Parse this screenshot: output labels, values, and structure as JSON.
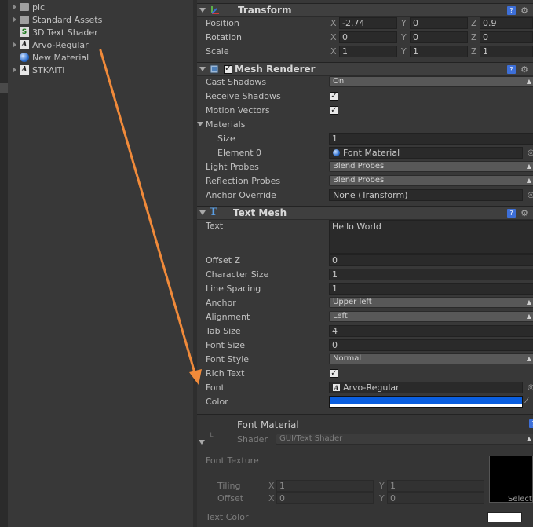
{
  "project": {
    "items": [
      {
        "name": "pic",
        "icon": "folder-icon",
        "expandable": true
      },
      {
        "name": "Standard Assets",
        "icon": "folder-icon",
        "expandable": true
      },
      {
        "name": "3D Text Shader",
        "icon": "shader-icon",
        "glyph": "S",
        "expandable": false
      },
      {
        "name": "Arvo-Regular",
        "icon": "font-icon",
        "glyph": "A",
        "expandable": true
      },
      {
        "name": "New Material",
        "icon": "material-icon",
        "expandable": false
      },
      {
        "name": "STKAITI",
        "icon": "font-icon",
        "glyph": "A",
        "expandable": true
      }
    ]
  },
  "transform": {
    "title": "Transform",
    "rows": [
      {
        "label": "Position",
        "x": "-2.74",
        "y": "0",
        "z": "0.9"
      },
      {
        "label": "Rotation",
        "x": "0",
        "y": "0",
        "z": "0"
      },
      {
        "label": "Scale",
        "x": "1",
        "y": "1",
        "z": "1"
      }
    ],
    "axis": {
      "x": "X",
      "y": "Y",
      "z": "Z"
    }
  },
  "mesh_renderer": {
    "title": "Mesh Renderer",
    "enabled": true,
    "cast_shadows": {
      "label": "Cast Shadows",
      "value": "On"
    },
    "receive_shadows": {
      "label": "Receive Shadows",
      "checked": true
    },
    "motion_vectors": {
      "label": "Motion Vectors",
      "checked": true
    },
    "materials": {
      "label": "Materials",
      "size_label": "Size",
      "size": "1",
      "element_label": "Element 0",
      "element_value": "Font Material"
    },
    "light_probes": {
      "label": "Light Probes",
      "value": "Blend Probes"
    },
    "reflection_probes": {
      "label": "Reflection Probes",
      "value": "Blend Probes"
    },
    "anchor_override": {
      "label": "Anchor Override",
      "value": "None (Transform)"
    }
  },
  "text_mesh": {
    "title": "Text Mesh",
    "icon_glyph": "T",
    "text": {
      "label": "Text",
      "value": "Hello World"
    },
    "offset_z": {
      "label": "Offset Z",
      "value": "0"
    },
    "character_size": {
      "label": "Character Size",
      "value": "1"
    },
    "line_spacing": {
      "label": "Line Spacing",
      "value": "1"
    },
    "anchor": {
      "label": "Anchor",
      "value": "Upper left"
    },
    "alignment": {
      "label": "Alignment",
      "value": "Left"
    },
    "tab_size": {
      "label": "Tab Size",
      "value": "4"
    },
    "font_size": {
      "label": "Font Size",
      "value": "0"
    },
    "font_style": {
      "label": "Font Style",
      "value": "Normal"
    },
    "rich_text": {
      "label": "Rich Text",
      "checked": true
    },
    "font": {
      "label": "Font",
      "value": "Arvo-Regular"
    },
    "color": {
      "label": "Color",
      "value": "#0b5fe0"
    }
  },
  "material": {
    "title": "Font Material",
    "shader_label": "Shader",
    "shader_value": "GUI/Text Shader",
    "font_texture_label": "Font Texture",
    "tiling": {
      "label": "Tiling",
      "x": "1",
      "y": "1"
    },
    "offset": {
      "label": "Offset",
      "x": "0",
      "y": "0"
    },
    "select_label": "Select",
    "text_color_label": "Text Color",
    "text_color": "#ffffff"
  },
  "annotation": {
    "arrow_color": "#f08a3a"
  }
}
